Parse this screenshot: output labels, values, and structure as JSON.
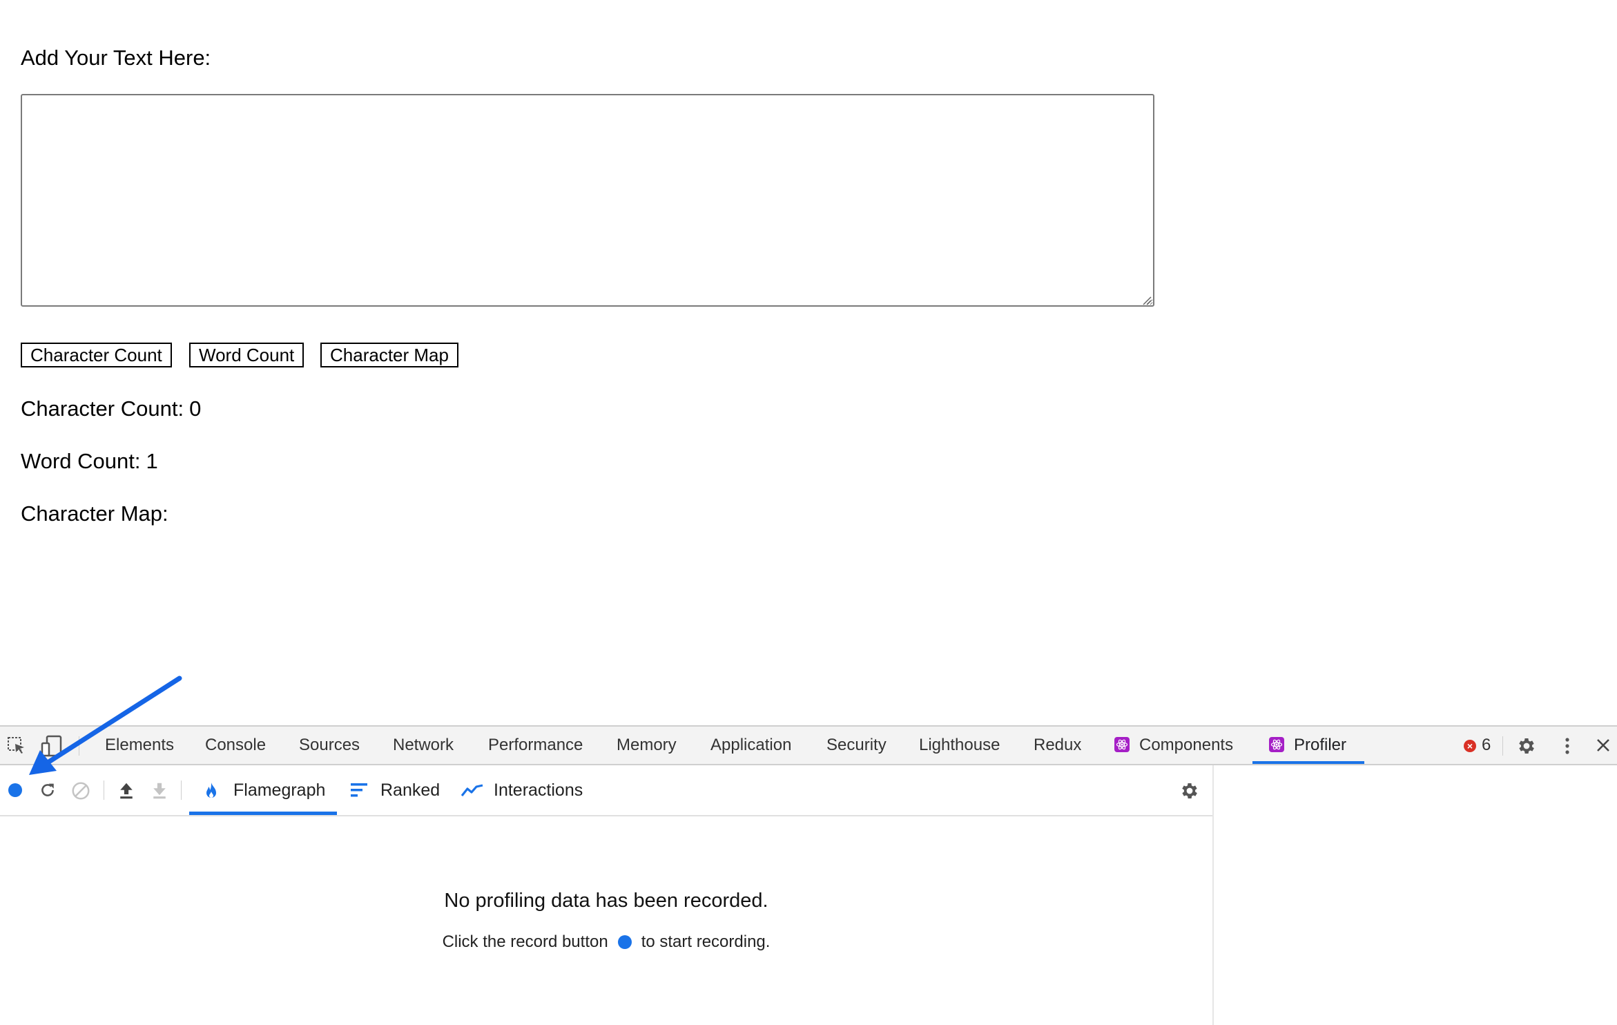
{
  "page": {
    "input_label": "Add Your Text Here:",
    "textarea_value": "",
    "buttons": {
      "char_count": "Character Count",
      "word_count": "Word Count",
      "char_map": "Character Map"
    },
    "results": {
      "char_count_label": "Character Count:",
      "char_count_value": "0",
      "word_count_label": "Word Count:",
      "word_count_value": "1",
      "char_map_label": "Character Map:"
    }
  },
  "devtools": {
    "tabs": [
      "Elements",
      "Console",
      "Sources",
      "Network",
      "Performance",
      "Memory",
      "Application",
      "Security",
      "Lighthouse",
      "Redux",
      "Components",
      "Profiler"
    ],
    "active_tab": "Profiler",
    "error_count": "6",
    "profiler": {
      "tabs": [
        "Flamegraph",
        "Ranked",
        "Interactions"
      ],
      "active_tab": "Flamegraph",
      "empty_title": "No profiling data has been recorded.",
      "empty_sub_before": "Click the record button",
      "empty_sub_after": "to start recording."
    }
  },
  "colors": {
    "accent": "#1a73e8",
    "react_badge": "#a51fc6",
    "annotation_arrow": "#1565e6",
    "error": "#d93025"
  }
}
